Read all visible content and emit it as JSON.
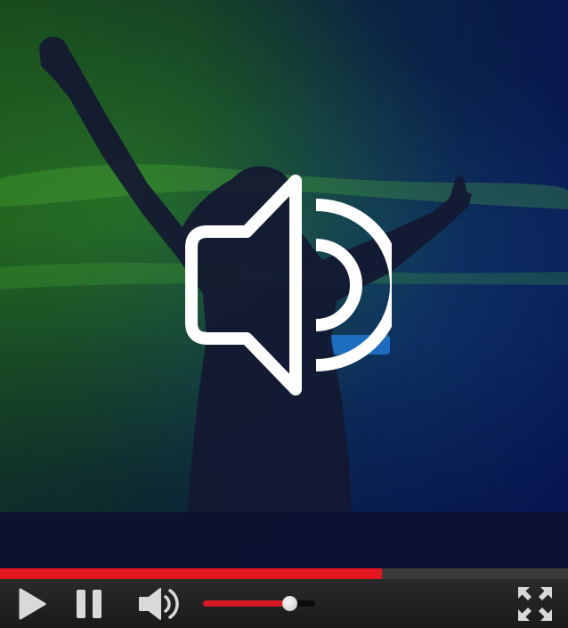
{
  "player": {
    "progress_fraction": 0.672,
    "volume_fraction": 0.77,
    "colors": {
      "accent": "#e3161f",
      "controls_bg": "#222222",
      "icon": "#d9d9d9",
      "overlay_icon": "#ffffff"
    },
    "icons": {
      "center": "speaker-volume-icon",
      "play": "play-icon",
      "pause": "pause-icon",
      "volume": "speaker-volume-icon",
      "fullscreen": "fullscreen-expand-icon"
    }
  }
}
